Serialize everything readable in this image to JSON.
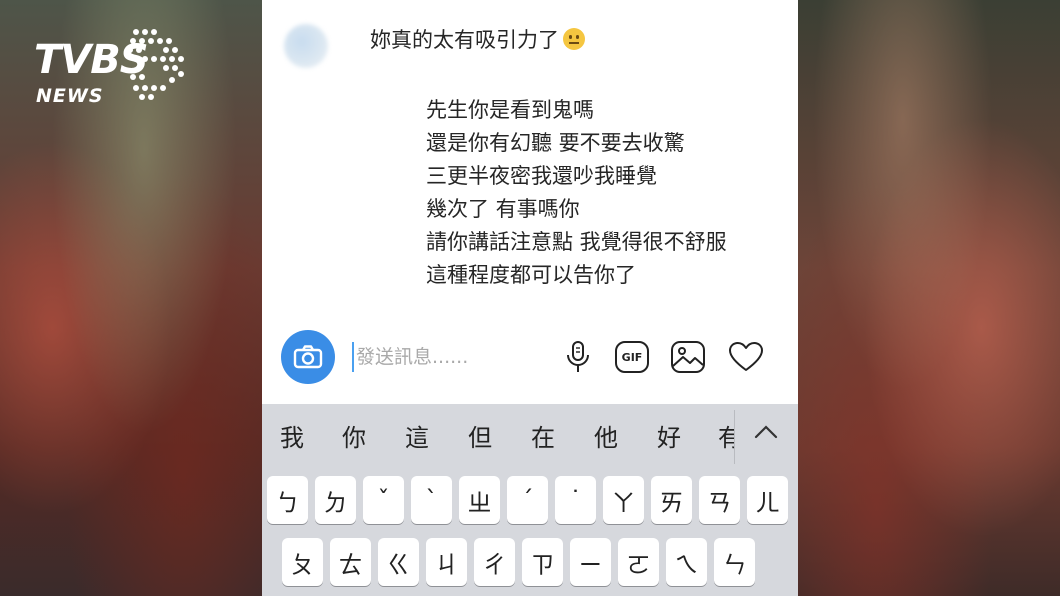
{
  "logo": {
    "main": "TVBS",
    "sub": "NEWS"
  },
  "chat": {
    "top_message": "妳真的太有吸引力了",
    "top_emoji": "neutral-face-emoji",
    "reply_lines": [
      "先生你是看到鬼嗎",
      "還是你有幻聽 要不要去收驚",
      "三更半夜密我還吵我睡覺",
      "幾次了 有事嗎你",
      "請你講話注意點 我覺得很不舒服",
      "這種程度都可以告你了"
    ]
  },
  "composer": {
    "camera_icon": "camera-icon",
    "placeholder": "發送訊息......",
    "mic_icon": "microphone-icon",
    "gif_label": "GIF",
    "image_icon": "image-icon",
    "heart_icon": "heart-icon"
  },
  "keyboard": {
    "candidates": [
      "我",
      "你",
      "這",
      "但",
      "在",
      "他",
      "好",
      "有"
    ],
    "row1": [
      "ㄅ",
      "ㄉ",
      "ˇ",
      "ˋ",
      "ㄓ",
      "ˊ",
      "˙",
      "ㄚ",
      "ㄞ",
      "ㄢ",
      "ㄦ"
    ],
    "row2": [
      "ㄆ",
      "ㄊ",
      "ㄍ",
      "ㄐ",
      "ㄔ",
      "ㄗ",
      "ㄧ",
      "ㄛ",
      "ㄟ",
      "ㄣ"
    ]
  },
  "colors": {
    "accent": "#3a8de6",
    "keyboard_bg": "#d6d8dd"
  }
}
